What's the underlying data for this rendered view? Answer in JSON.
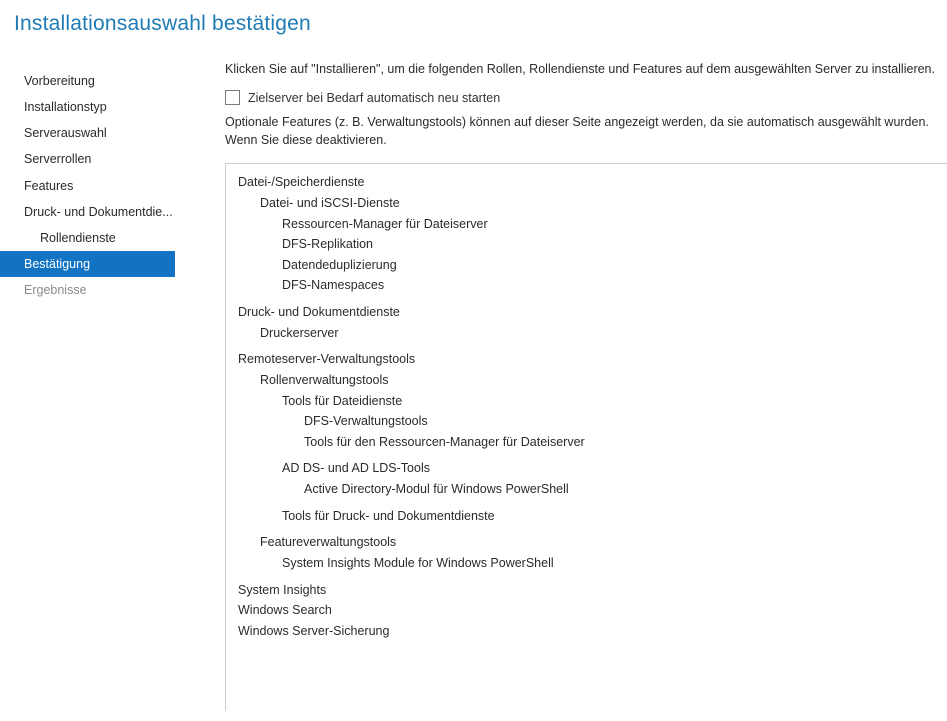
{
  "title": "Installationsauswahl bestätigen",
  "sidebar": {
    "items": [
      {
        "label": "Vorbereitung",
        "selected": false,
        "disabled": false,
        "indent": false
      },
      {
        "label": "Installationstyp",
        "selected": false,
        "disabled": false,
        "indent": false
      },
      {
        "label": "Serverauswahl",
        "selected": false,
        "disabled": false,
        "indent": false
      },
      {
        "label": "Serverrollen",
        "selected": false,
        "disabled": false,
        "indent": false
      },
      {
        "label": "Features",
        "selected": false,
        "disabled": false,
        "indent": false
      },
      {
        "label": "Druck- und Dokumentdie...",
        "selected": false,
        "disabled": false,
        "indent": false
      },
      {
        "label": "Rollendienste",
        "selected": false,
        "disabled": false,
        "indent": true
      },
      {
        "label": "Bestätigung",
        "selected": true,
        "disabled": false,
        "indent": false
      },
      {
        "label": "Ergebnisse",
        "selected": false,
        "disabled": true,
        "indent": false
      }
    ]
  },
  "content": {
    "intro": "Klicken Sie auf \"Installieren\", um die folgenden Rollen, Rollendienste und Features auf dem ausgewählten Server zu installieren.",
    "autorestart_checkbox": {
      "checked": false,
      "label": "Zielserver bei Bedarf automatisch neu starten"
    },
    "optional_note": "Optionale Features (z. B. Verwaltungstools) können auf dieser Seite angezeigt werden, da sie automatisch ausgewählt wurden. Wenn Sie diese deaktivieren."
  },
  "tree": [
    {
      "label": "Datei-/Speicherdienste",
      "depth": 0,
      "gap": false
    },
    {
      "label": "Datei- und iSCSI-Dienste",
      "depth": 1,
      "gap": false
    },
    {
      "label": "Ressourcen-Manager für Dateiserver",
      "depth": 2,
      "gap": false
    },
    {
      "label": "DFS-Replikation",
      "depth": 2,
      "gap": false
    },
    {
      "label": "Datendeduplizierung",
      "depth": 2,
      "gap": false
    },
    {
      "label": "DFS-Namespaces",
      "depth": 2,
      "gap": false
    },
    {
      "label": "Druck- und Dokumentdienste",
      "depth": 0,
      "gap": true
    },
    {
      "label": "Druckerserver",
      "depth": 1,
      "gap": false
    },
    {
      "label": "Remoteserver-Verwaltungstools",
      "depth": 0,
      "gap": true
    },
    {
      "label": "Rollenverwaltungstools",
      "depth": 1,
      "gap": false
    },
    {
      "label": "Tools für Dateidienste",
      "depth": 2,
      "gap": false
    },
    {
      "label": "DFS-Verwaltungstools",
      "depth": 3,
      "gap": false
    },
    {
      "label": "Tools für den Ressourcen-Manager für Dateiserver",
      "depth": 3,
      "gap": false
    },
    {
      "label": "AD DS- und AD LDS-Tools",
      "depth": 2,
      "gap": true
    },
    {
      "label": "Active Directory-Modul für Windows PowerShell",
      "depth": 3,
      "gap": false
    },
    {
      "label": "Tools für Druck- und Dokumentdienste",
      "depth": 2,
      "gap": true
    },
    {
      "label": "Featureverwaltungstools",
      "depth": 1,
      "gap": true
    },
    {
      "label": "System Insights Module for Windows PowerShell",
      "depth": 2,
      "gap": false
    },
    {
      "label": "System Insights",
      "depth": 0,
      "gap": true
    },
    {
      "label": "Windows Search",
      "depth": 0,
      "gap": false
    },
    {
      "label": "Windows Server-Sicherung",
      "depth": 0,
      "gap": false
    }
  ]
}
